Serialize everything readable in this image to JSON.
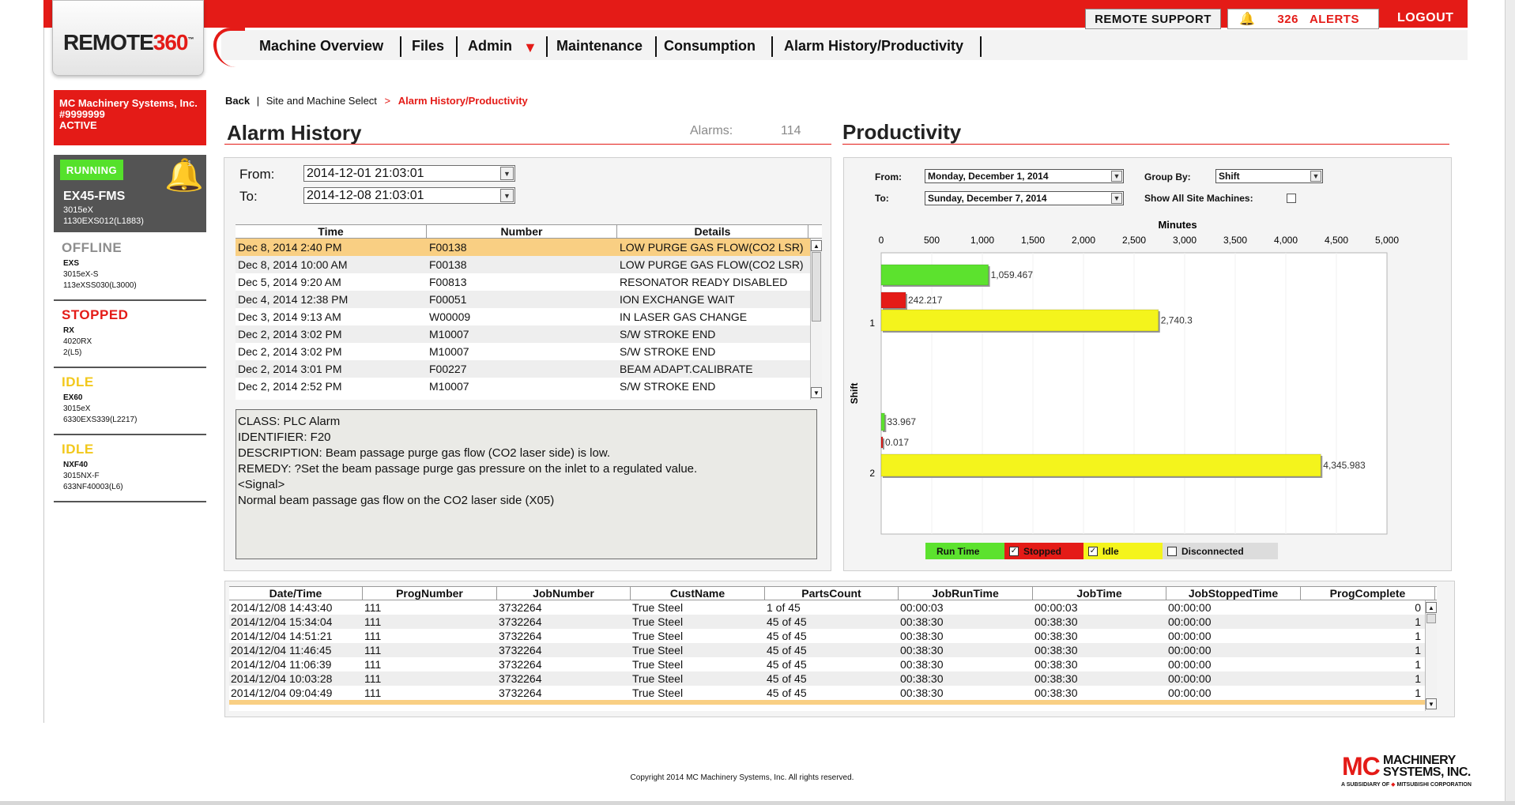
{
  "header": {
    "logo": {
      "main": "REMOTE",
      "accent": "360",
      "tm": "™"
    },
    "remote_support": "REMOTE SUPPORT",
    "alerts_count": "326",
    "alerts_label": "ALERTS",
    "logout": "LOGOUT"
  },
  "nav": {
    "items": [
      "Machine Overview",
      "Files",
      "Admin",
      "Maintenance",
      "Consumption",
      "Alarm History/Productivity"
    ]
  },
  "sidebar": {
    "site": {
      "name": "MC Machinery Systems, Inc.",
      "id": "#9999999",
      "status": "ACTIVE"
    },
    "running": {
      "badge": "RUNNING",
      "bell_count": "1",
      "model": "EX45-FMS",
      "line1": "3015eX",
      "line2": "1130EXS012(L1883)"
    },
    "machines": [
      {
        "status": "OFFLINE",
        "color": "#8e8e8e",
        "model": "EXS",
        "line1": "3015eX-S",
        "line2": "113eXSS030(L3000)"
      },
      {
        "status": "STOPPED",
        "color": "#e41b17",
        "model": "RX",
        "line1": "4020RX",
        "line2": "2(L5)"
      },
      {
        "status": "IDLE",
        "color": "#f2c81c",
        "model": "EX60",
        "line1": "3015eX",
        "line2": "6330EXS339(L2217)"
      },
      {
        "status": "IDLE",
        "color": "#f2c81c",
        "model": "NXF40",
        "line1": "3015NX-F",
        "line2": "633NF40003(L6)"
      }
    ]
  },
  "breadcrumb": {
    "back": "Back",
    "sep": "|",
    "site": "Site and Machine Select",
    "arrow": ">",
    "current": "Alarm History/Productivity"
  },
  "alarm_history": {
    "title": "Alarm History",
    "alarms_label": "Alarms:",
    "alarms_count": "114",
    "from_label": "From:",
    "from_value": "2014-12-01 21:03:01",
    "to_label": "To:",
    "to_value": "2014-12-08 21:03:01",
    "columns": [
      "Time",
      "Number",
      "Details"
    ],
    "rows": [
      [
        "Dec 8, 2014 2:40 PM",
        "F00138",
        "LOW PURGE GAS FLOW(CO2 LSR)"
      ],
      [
        "Dec 8, 2014 10:00 AM",
        "F00138",
        "LOW PURGE GAS FLOW(CO2 LSR)"
      ],
      [
        "Dec 5, 2014 9:20 AM",
        "F00813",
        "RESONATOR READY DISABLED"
      ],
      [
        "Dec 4, 2014 12:38 PM",
        "F00051",
        "ION EXCHANGE WAIT"
      ],
      [
        "Dec 3, 2014 9:13 AM",
        "W00009",
        "IN LASER GAS CHANGE"
      ],
      [
        "Dec 2, 2014 3:02 PM",
        "M10007",
        "S/W STROKE END"
      ],
      [
        "Dec 2, 2014 3:02 PM",
        "M10007",
        "S/W STROKE END"
      ],
      [
        "Dec 2, 2014 3:01 PM",
        "F00227",
        "BEAM ADAPT.CALIBRATE"
      ],
      [
        "Dec 2, 2014 2:52 PM",
        "M10007",
        "S/W STROKE END"
      ]
    ],
    "detail_lines": [
      "CLASS: PLC Alarm",
      "IDENTIFIER: F20",
      "DESCRIPTION: Beam passage purge gas flow (CO2 laser side) is low.",
      "REMEDY: ?Set the beam passage purge gas pressure on the inlet to a regulated value.",
      "<Signal>",
      "Normal beam passage gas flow on the CO2 laser side (X05)"
    ]
  },
  "productivity": {
    "title": "Productivity",
    "from_label": "From:",
    "from_value": "Monday, December 1, 2014",
    "to_label": "To:",
    "to_value": "Sunday, December 7, 2014",
    "group_label": "Group By:",
    "group_value": "Shift",
    "show_all_label": "Show All Site Machines:",
    "legend": [
      {
        "label": "Run Time",
        "color": "#5ce22e",
        "checked": false,
        "has_box": false
      },
      {
        "label": "Stopped",
        "color": "#e41b17",
        "checked": true,
        "has_box": true
      },
      {
        "label": "Idle",
        "color": "#f4f41c",
        "checked": true,
        "has_box": true
      },
      {
        "label": "Disconnected",
        "color": "#dcdcdc",
        "checked": false,
        "has_box": true
      }
    ]
  },
  "chart_data": {
    "type": "bar",
    "orientation": "horizontal",
    "xlabel": "Minutes",
    "ylabel": "Shift",
    "xlim": [
      0,
      5000
    ],
    "xticks": [
      0,
      500,
      1000,
      1500,
      2000,
      2500,
      3000,
      3500,
      4000,
      4500,
      5000
    ],
    "xtick_labels": [
      "0",
      "500",
      "1,000",
      "1,500",
      "2,000",
      "2,500",
      "3,000",
      "3,500",
      "4,000",
      "4,500",
      "5,000"
    ],
    "categories": [
      "1",
      "2"
    ],
    "series": [
      {
        "name": "Run Time",
        "color": "#5ce22e",
        "values": [
          1059.467,
          33.967
        ],
        "labels": [
          "1,059.467",
          "33.967"
        ]
      },
      {
        "name": "Stopped",
        "color": "#e41b17",
        "values": [
          242.217,
          0.017
        ],
        "labels": [
          "242.217",
          "0.017"
        ]
      },
      {
        "name": "Idle",
        "color": "#f4f41c",
        "values": [
          2740.3,
          4345.983
        ],
        "labels": [
          "2,740.3",
          "4,345.983"
        ]
      }
    ]
  },
  "jobs": {
    "columns": [
      "Date/Time",
      "ProgNumber",
      "JobNumber",
      "CustName",
      "PartsCount",
      "JobRunTime",
      "JobTime",
      "JobStoppedTime",
      "ProgComplete"
    ],
    "rows": [
      [
        "2014/12/08 14:43:40",
        "111",
        "3732264",
        "True Steel",
        "1 of 45",
        "00:00:03",
        "00:00:03",
        "00:00:00",
        "0"
      ],
      [
        "2014/12/04 15:34:04",
        "111",
        "3732264",
        "True Steel",
        "45 of 45",
        "00:38:30",
        "00:38:30",
        "00:00:00",
        "1"
      ],
      [
        "2014/12/04 14:51:21",
        "111",
        "3732264",
        "True Steel",
        "45 of 45",
        "00:38:30",
        "00:38:30",
        "00:00:00",
        "1"
      ],
      [
        "2014/12/04 11:46:45",
        "111",
        "3732264",
        "True Steel",
        "45 of 45",
        "00:38:30",
        "00:38:30",
        "00:00:00",
        "1"
      ],
      [
        "2014/12/04 11:06:39",
        "111",
        "3732264",
        "True Steel",
        "45 of 45",
        "00:38:30",
        "00:38:30",
        "00:00:00",
        "1"
      ],
      [
        "2014/12/04 10:03:28",
        "111",
        "3732264",
        "True Steel",
        "45 of 45",
        "00:38:30",
        "00:38:30",
        "00:00:00",
        "1"
      ],
      [
        "2014/12/04 09:04:49",
        "111",
        "3732264",
        "True Steel",
        "45 of 45",
        "00:38:30",
        "00:38:30",
        "00:00:00",
        "1"
      ]
    ]
  },
  "footer": {
    "copyright": "Copyright 2014 MC Machinery Systems, Inc. All rights reserved.",
    "logo_mc": "MC",
    "logo_line1": "MACHINERY",
    "logo_line2": "SYSTEMS, INC.",
    "logo_sub": "A SUBSIDIARY OF",
    "logo_sub_brand": "MITSUBISHI CORPORATION"
  }
}
